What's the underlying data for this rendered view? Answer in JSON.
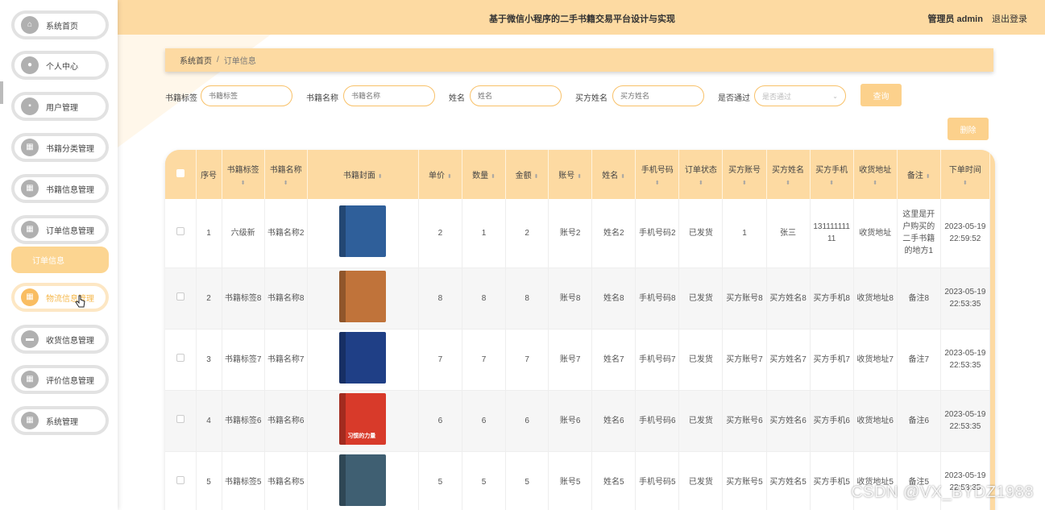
{
  "sidebar": {
    "items": [
      {
        "label": "系统首页",
        "icon": "home-icon",
        "glyph": "⌂"
      },
      {
        "label": "个人中心",
        "icon": "user-icon",
        "glyph": "●"
      },
      {
        "label": "用户管理",
        "icon": "chat-icon",
        "glyph": "▪"
      },
      {
        "label": "书籍分类管理",
        "icon": "grid-icon",
        "glyph": "▦"
      },
      {
        "label": "书籍信息管理",
        "icon": "grid-icon",
        "glyph": "▦"
      },
      {
        "label": "订单信息管理",
        "icon": "grid-icon",
        "glyph": "▦"
      },
      {
        "label": "物流信息管理",
        "icon": "grid-icon",
        "glyph": "▦"
      },
      {
        "label": "收货信息管理",
        "icon": "briefcase-icon",
        "glyph": "▬"
      },
      {
        "label": "评价信息管理",
        "icon": "grid-icon",
        "glyph": "▦"
      },
      {
        "label": "系统管理",
        "icon": "grid-icon",
        "glyph": "▦"
      }
    ],
    "submenu_label": "订单信息"
  },
  "header": {
    "title": "基于微信小程序的二手书籍交易平台设计与实现",
    "user_label": "管理员 admin",
    "logout_label": "退出登录"
  },
  "breadcrumb": {
    "home": "系统首页",
    "separator": "/",
    "current": "订单信息"
  },
  "search": {
    "fields": [
      {
        "label": "书籍标签",
        "placeholder": "书籍标签"
      },
      {
        "label": "书籍名称",
        "placeholder": "书籍名称"
      },
      {
        "label": "姓名",
        "placeholder": "姓名"
      },
      {
        "label": "买方姓名",
        "placeholder": "买方姓名"
      }
    ],
    "select": {
      "label": "是否通过",
      "placeholder": "是否通过"
    },
    "query_label": "查询",
    "delete_label": "删除"
  },
  "table": {
    "columns": [
      "序号",
      "书籍标签",
      "书籍名称",
      "书籍封面",
      "单价",
      "数量",
      "金额",
      "账号",
      "姓名",
      "手机号码",
      "订单状态",
      "买方账号",
      "买方姓名",
      "买方手机",
      "收货地址",
      "备注",
      "下单时间"
    ],
    "rows": [
      {
        "cells": [
          "1",
          "六级新",
          "书籍名称2",
          "",
          "2",
          "1",
          "2",
          "账号2",
          "姓名2",
          "手机号码2",
          "已发货",
          "1",
          "张三",
          "13111111111",
          "收货地址",
          "这里是开户购买的二手书籍的地方1",
          "2023-05-19 22:59:52"
        ],
        "cover_color": "#2f5f9a",
        "cover_tag": ""
      },
      {
        "cells": [
          "2",
          "书籍标签8",
          "书籍名称8",
          "",
          "8",
          "8",
          "8",
          "账号8",
          "姓名8",
          "手机号码8",
          "已发货",
          "买方账号8",
          "买方姓名8",
          "买方手机8",
          "收货地址8",
          "备注8",
          "2023-05-19 22:53:35"
        ],
        "cover_color": "#c0733a",
        "cover_tag": ""
      },
      {
        "cells": [
          "3",
          "书籍标签7",
          "书籍名称7",
          "",
          "7",
          "7",
          "7",
          "账号7",
          "姓名7",
          "手机号码7",
          "已发货",
          "买方账号7",
          "买方姓名7",
          "买方手机7",
          "收货地址7",
          "备注7",
          "2023-05-19 22:53:35"
        ],
        "cover_color": "#1f3f86",
        "cover_tag": ""
      },
      {
        "cells": [
          "4",
          "书籍标签6",
          "书籍名称6",
          "",
          "6",
          "6",
          "6",
          "账号6",
          "姓名6",
          "手机号码6",
          "已发货",
          "买方账号6",
          "买方姓名6",
          "买方手机6",
          "收货地址6",
          "备注6",
          "2023-05-19 22:53:35"
        ],
        "cover_color": "#d83a2a",
        "cover_tag": "习惯的力量"
      },
      {
        "cells": [
          "5",
          "书籍标签5",
          "书籍名称5",
          "",
          "5",
          "5",
          "5",
          "账号5",
          "姓名5",
          "手机号码5",
          "已发货",
          "买方账号5",
          "买方姓名5",
          "买方手机5",
          "收货地址5",
          "备注5",
          "2023-05-19 22:53:35"
        ],
        "cover_color": "#3f5f72",
        "cover_tag": ""
      }
    ]
  },
  "watermark": "CSDN @VX_BYDZ1988"
}
